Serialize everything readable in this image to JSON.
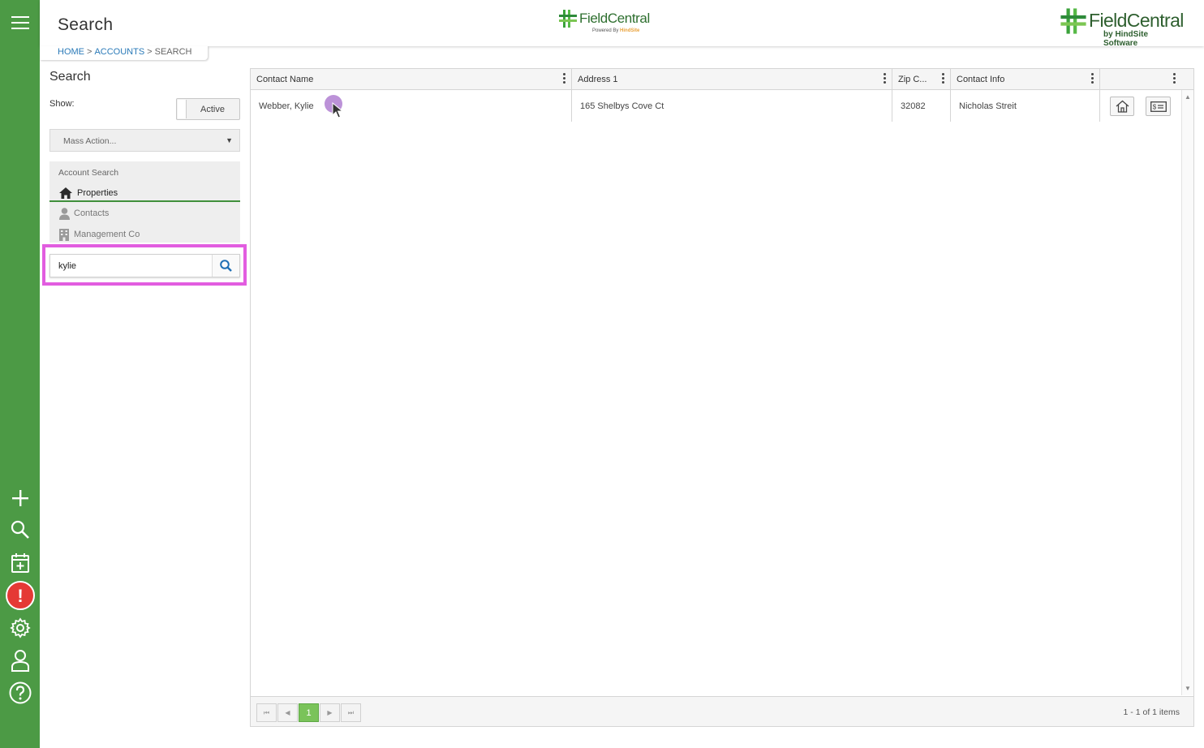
{
  "header": {
    "page_title": "Search",
    "center_logo": {
      "brand": "FieldCentral",
      "powered": "Powered By",
      "partner": "HindSite"
    },
    "right_logo": {
      "brand": "FieldCentral",
      "tagline": "by HindSite Software"
    }
  },
  "breadcrumb": {
    "home": "HOME",
    "accounts": "ACCOUNTS",
    "current": "SEARCH",
    "separator": ">"
  },
  "rail": {
    "items": [
      "menu-icon",
      "plus-icon",
      "search-icon",
      "calendar-add-icon",
      "alert-icon",
      "gear-icon",
      "user-icon",
      "help-icon"
    ],
    "alert_glyph": "!",
    "colors": {
      "rail_bg": "#4c9a45",
      "alert": "#e53935"
    }
  },
  "left_panel": {
    "title": "Search",
    "show_label": "Show:",
    "toggle_label": "Active",
    "mass_action": {
      "label": "Mass Action...",
      "caret": "▼"
    },
    "account_search": {
      "heading": "Account Search",
      "items": [
        {
          "label": "Properties",
          "icon": "home-icon",
          "active": true
        },
        {
          "label": "Contacts",
          "icon": "person-icon",
          "active": false
        },
        {
          "label": "Management Co",
          "icon": "building-icon",
          "active": false
        }
      ]
    },
    "search": {
      "value": "kylie",
      "placeholder": ""
    }
  },
  "grid": {
    "columns": [
      "Contact Name",
      "Address 1",
      "Zip C...",
      "Contact Info",
      ""
    ],
    "rows": [
      {
        "contact_name": "Webber, Kylie",
        "address1": "165 Shelbys Cove Ct",
        "zip": "32082",
        "contact_info": "Nicholas Streit"
      }
    ],
    "row_actions": [
      "home-icon",
      "billing-icon"
    ],
    "pager": {
      "first": "⏮",
      "prev": "◀",
      "current_page": "1",
      "next": "▶",
      "last": "⏭",
      "info": "1 - 1 of 1 items"
    },
    "colors": {
      "accent": "#7ac35a",
      "highlight_box": "#e25de0"
    }
  }
}
